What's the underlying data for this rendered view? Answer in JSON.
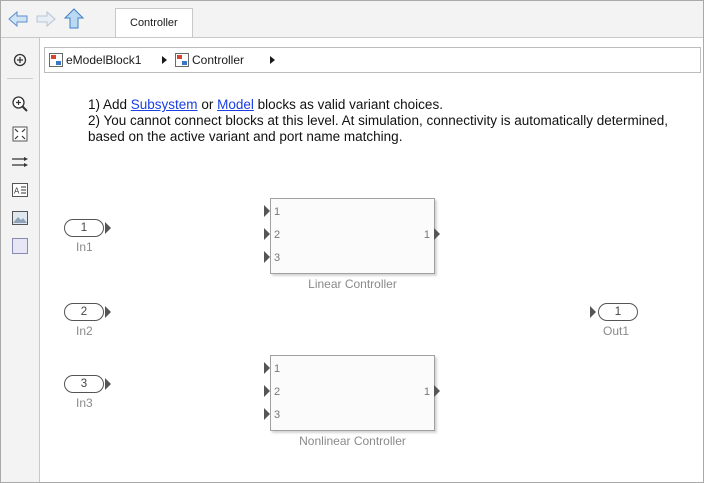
{
  "toolbar": {
    "back_icon": "back-arrow-icon",
    "forward_icon": "forward-arrow-icon",
    "up_icon": "up-arrow-icon",
    "tab_label": "Controller"
  },
  "breadcrumb": {
    "items": [
      {
        "label": "eModelBlock1",
        "icon": "model-icon"
      },
      {
        "label": "Controller",
        "icon": "subsystem-icon"
      }
    ]
  },
  "left_tools": [
    {
      "name": "hide-explorer-icon"
    },
    {
      "name": "zoom-icon"
    },
    {
      "name": "fit-view-icon"
    },
    {
      "name": "signal-routing-icon"
    },
    {
      "name": "annotation-icon"
    },
    {
      "name": "image-icon"
    },
    {
      "name": "area-icon"
    }
  ],
  "note": {
    "line1_pre": "1) Add ",
    "line1_link1": "Subsystem",
    "line1_mid": " or ",
    "line1_link2": "Model",
    "line1_post": " blocks as valid variant choices.",
    "line2": "2) You cannot connect blocks at this level. At simulation, connectivity is automatically determined, based on the active variant and port name matching."
  },
  "inports": [
    {
      "number": "1",
      "label": "In1"
    },
    {
      "number": "2",
      "label": "In2"
    },
    {
      "number": "3",
      "label": "In3"
    }
  ],
  "outports": [
    {
      "number": "1",
      "label": "Out1"
    }
  ],
  "blocks": [
    {
      "name": "Linear Controller",
      "inputs": [
        "1",
        "2",
        "3"
      ],
      "output": "1"
    },
    {
      "name": "Nonlinear Controller",
      "inputs": [
        "1",
        "2",
        "3"
      ],
      "output": "1"
    }
  ]
}
